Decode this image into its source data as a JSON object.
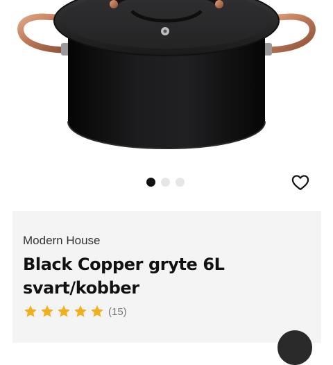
{
  "product": {
    "brand": "Modern House",
    "title_line1": "Black Copper gryte 6L",
    "title_line2": "svart/kobber",
    "rating_stars": 5,
    "rating_count": "(15)"
  },
  "gallery": {
    "image_count": 3,
    "active_image": 1,
    "image_subject": "pot-image"
  },
  "icons": {
    "favorite": "heart-outline-icon",
    "star": "star-icon"
  },
  "colors": {
    "star": "#f2b01e",
    "card_background": "#f4f4f4",
    "dot_active": "#111111",
    "dot_inactive": "#e6e6e6",
    "copper": "#c17f59"
  }
}
